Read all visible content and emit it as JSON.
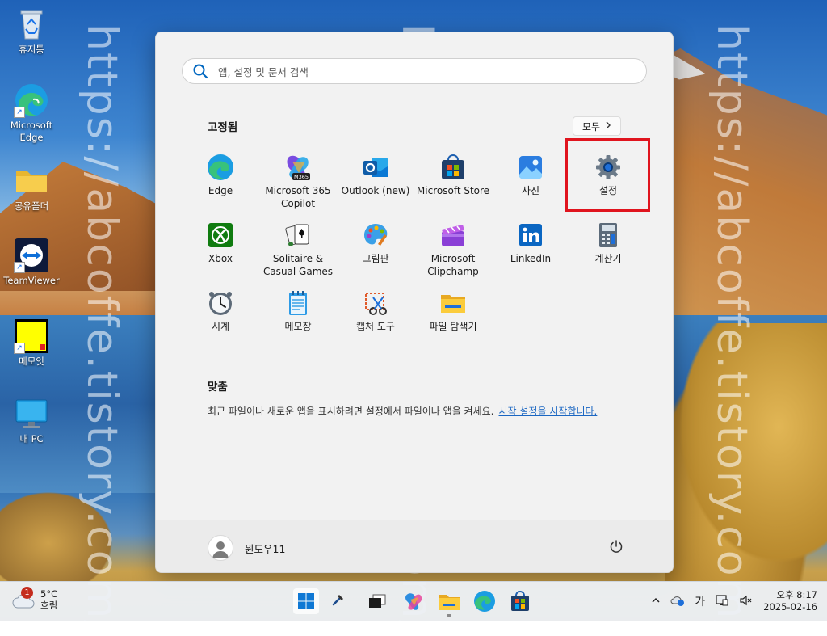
{
  "watermark": "https://abcoffe.tistory.com/",
  "desktop": {
    "icons": [
      {
        "label": "휴지통",
        "icon": "recycle-bin-icon"
      },
      {
        "label": "Microsoft Edge",
        "icon": "edge-icon"
      },
      {
        "label": "공유폴더",
        "icon": "folder-icon"
      },
      {
        "label": "TeamViewer",
        "icon": "teamviewer-icon"
      },
      {
        "label": "메모잇",
        "icon": "sticky-note-icon"
      },
      {
        "label": "내 PC",
        "icon": "monitor-icon"
      }
    ]
  },
  "start_menu": {
    "search": {
      "placeholder": "앱, 설정 및 문서 검색"
    },
    "pinned": {
      "title": "고정됨",
      "all_button": "모두",
      "apps": [
        {
          "label": "Edge",
          "icon": "edge-icon"
        },
        {
          "label": "Microsoft 365 Copilot",
          "icon": "m365-copilot-icon"
        },
        {
          "label": "Outlook (new)",
          "icon": "outlook-icon"
        },
        {
          "label": "Microsoft Store",
          "icon": "store-icon"
        },
        {
          "label": "사진",
          "icon": "photos-icon"
        },
        {
          "label": "설정",
          "icon": "gear-icon"
        },
        {
          "label": "Xbox",
          "icon": "xbox-icon"
        },
        {
          "label": "Solitaire & Casual Games",
          "icon": "solitaire-icon"
        },
        {
          "label": "그림판",
          "icon": "paint-icon"
        },
        {
          "label": "Microsoft Clipchamp",
          "icon": "clipchamp-icon"
        },
        {
          "label": "LinkedIn",
          "icon": "linkedin-icon"
        },
        {
          "label": "계산기",
          "icon": "calculator-icon"
        },
        {
          "label": "시계",
          "icon": "clock-icon"
        },
        {
          "label": "메모장",
          "icon": "notepad-icon"
        },
        {
          "label": "캡처 도구",
          "icon": "snipping-tool-icon"
        },
        {
          "label": "파일 탐색기",
          "icon": "file-explorer-icon"
        }
      ],
      "highlighted": "설정"
    },
    "recommended": {
      "title": "맞춤",
      "text": "최근 파일이나 새로운 앱을 표시하려면 설정에서 파일이나 앱을 켜세요.",
      "link": "시작 설정을 시작합니다."
    },
    "user": {
      "name": "윈도우11"
    }
  },
  "taskbar": {
    "weather": {
      "temp": "5°C",
      "condition": "흐림",
      "badge": "1"
    },
    "pinned": [
      "start-icon",
      "tool-icon",
      "task-view-icon",
      "copilot-icon",
      "file-explorer-icon",
      "edge-icon",
      "store-icon"
    ],
    "tray": {
      "ime": "가",
      "time": "오후 8:17",
      "date": "2025-02-16"
    }
  },
  "colors": {
    "accent": "#0067c0",
    "highlight_box": "#e0141e"
  }
}
